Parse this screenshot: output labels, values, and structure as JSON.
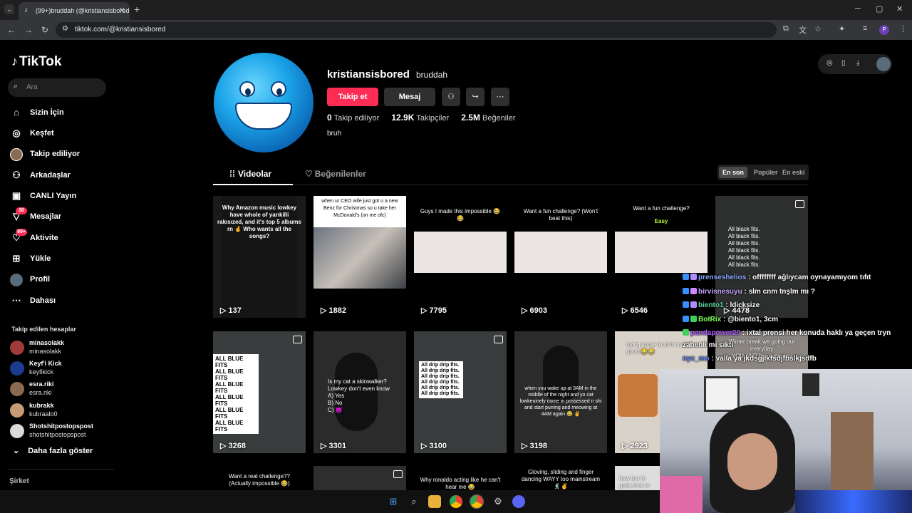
{
  "browser": {
    "tab_title": "(99+)bruddah (@kristiansisbored",
    "url": "tiktok.com/@kristiansisbored"
  },
  "sidebar": {
    "logo": "TikTok",
    "search_placeholder": "Ara",
    "nav": [
      {
        "label": "Sizin İçin",
        "icon": "home-icon"
      },
      {
        "label": "Keşfet",
        "icon": "compass-icon"
      },
      {
        "label": "Takip ediliyor",
        "icon": "following-avatar-icon"
      },
      {
        "label": "Arkadaşlar",
        "icon": "friends-icon"
      },
      {
        "label": "CANLI Yayın",
        "icon": "live-icon"
      },
      {
        "label": "Mesajlar",
        "icon": "messages-icon",
        "badge": "30"
      },
      {
        "label": "Aktivite",
        "icon": "activity-icon",
        "badge": "99+"
      },
      {
        "label": "Yükle",
        "icon": "upload-icon"
      },
      {
        "label": "Profil",
        "icon": "profile-icon"
      },
      {
        "label": "Dahası",
        "icon": "more-icon"
      }
    ],
    "followed_heading": "Takip edilen hesaplar",
    "followed": [
      {
        "name": "minasolakk",
        "handle": "minasolakk",
        "color": "#a23a3a"
      },
      {
        "name": "Keyf'i Kick",
        "handle": "keyfikick",
        "color": "#1c3d8f"
      },
      {
        "name": "esra.riki",
        "handle": "esra.riki",
        "color": "#8a6a50"
      },
      {
        "name": "kubrakk",
        "handle": "kubraalo0",
        "color": "#c49b73"
      },
      {
        "name": "Shotshitpostopspost",
        "handle": "shotshitpostopspost",
        "color": "#d9d9d9"
      }
    ],
    "show_more": "Daha fazla göster",
    "company": "Şirket"
  },
  "profile": {
    "username": "kristiansisbored",
    "nickname": "bruddah",
    "follow_label": "Takip et",
    "message_label": "Mesaj",
    "stats": [
      {
        "value": "0",
        "label": "Takip ediliyor"
      },
      {
        "value": "12.9K",
        "label": "Takipçiler"
      },
      {
        "value": "2.5M",
        "label": "Beğeniler"
      }
    ],
    "bio": "bruh"
  },
  "tabs": {
    "videos": "Videolar",
    "liked": "Beğenilenler"
  },
  "sort": {
    "options": [
      "En son",
      "Popüler",
      "En eski"
    ],
    "selected": "En son"
  },
  "videos": [
    {
      "views": "137",
      "caption": "Why Amazon music lowkey have whole of yarıkilli rakısızed, and it's top 5 albums rn 🤞 Who wants all the songs?"
    },
    {
      "views": "1882",
      "caption": "when ur CEO wife just got u a new Benz for Christmas so u take her McDonald's (on me ofc)"
    },
    {
      "views": "7795",
      "caption": "Guys I made this impossible 😂😂"
    },
    {
      "views": "6903",
      "caption": "Want a fun challenge? (Won't beat this)"
    },
    {
      "views": "6546",
      "caption": "Want a fun challenge?",
      "sub": "Easy"
    },
    {
      "views": "4478",
      "caption": "All black fits.\nAll black fits.\nAll black fits.\nAll black fits.\nAll black fits.\nAll black fits."
    },
    {
      "views": "3268",
      "caption": "ALL BLUE FITS\nALL BLUE FITS\nALL BLUE FITS\nALL BLUE FITS\nALL BLUE FITS\nALL BLUE FITS"
    },
    {
      "views": "3301",
      "caption": "Is my cat a skinwalker? Lowkey don't even know\nA) Yes\nB) No\nC) 😈"
    },
    {
      "views": "3100",
      "caption": "All drip drip fits.\nAll drip drip fits.\nAll drip drip fits.\nAll drip drip fits.\nAll drip drip fits.\nAll drip drip fits."
    },
    {
      "views": "3198",
      "caption": "when you wake up at 3AM in the middle of the night and yo cat lowkeuinely come in possessed n shi and start purring and meowing at 4AM again 😂 ✌"
    },
    {
      "views": "2923",
      "caption": "trying some food to try it's good 😂😂"
    },
    {
      "views": "",
      "caption": "Winter break we going out everyday\nYOU AND bro everyday"
    },
    {
      "views": "",
      "caption": "Want a real challenge?? (Actually impossible 😂)"
    },
    {
      "views": "",
      "caption": ""
    },
    {
      "views": "",
      "caption": "Why ronaldo acting like he can't hear me 😂"
    },
    {
      "views": "",
      "caption": "Gloving, sliding and finger dancing WAYY too mainstream 🕺✌"
    },
    {
      "views": "",
      "caption": "how bro fe gotta lock in"
    }
  ],
  "chat": [
    {
      "user": "prenseshelios",
      "text": ": offffffff ağlıycam oynayamıyom tıfıt",
      "color": "#8aa8ff"
    },
    {
      "user": "birvisnesuyu",
      "text": ": slm cnm tnşlm mı ?",
      "color": "#c9a4ff"
    },
    {
      "user": "biento1",
      "text": ": ldicksize",
      "color": "#5ad6a0"
    },
    {
      "user": "BotRix",
      "text": ": @biento1, 3cm",
      "color": "#7fff5a"
    },
    {
      "user": "pandapower20",
      "text": ": ixtal prensi her konuda haklı ya geçen tryn",
      "color": "#b060ff"
    },
    {
      "user": "",
      "text": "zahenli mi sıktı",
      "color": "#ffffff"
    },
    {
      "user": "nyc_mo",
      "text": ": valla ya jkdsgjlkfsdjfbslkjsdfb",
      "color": "#6a8bff"
    }
  ],
  "colors": {
    "accent": "#fe2c55",
    "background": "#000000"
  }
}
